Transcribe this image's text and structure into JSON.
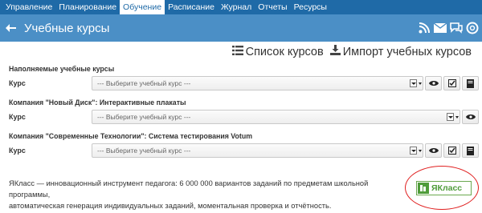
{
  "nav": {
    "items": [
      {
        "label": "Управление"
      },
      {
        "label": "Планирование"
      },
      {
        "label": "Обучение",
        "active": true
      },
      {
        "label": "Расписание"
      },
      {
        "label": "Журнал"
      },
      {
        "label": "Отчеты"
      },
      {
        "label": "Ресурсы"
      }
    ]
  },
  "page": {
    "title": "Учебные курсы",
    "header_icons": [
      "rss-icon",
      "mail-icon",
      "chat-icon",
      "help-icon"
    ]
  },
  "actions": {
    "list_label": "Список курсов",
    "import_label": "Импорт учебных курсов"
  },
  "sections": [
    {
      "title": "Наполняемые учебные курсы",
      "field_label": "Курс",
      "placeholder": "--- Выберите учебный курс ---"
    },
    {
      "title": "Компания \"Новый Диск\": Интерактивные плакаты",
      "field_label": "Курс",
      "placeholder": "--- Выберите учебный курс ---"
    },
    {
      "title": "Компания \"Современные Технологии\": Система тестирования Votum",
      "field_label": "Курс",
      "placeholder": "--- Выберите учебный курс ---"
    }
  ],
  "footer": {
    "line1": "ЯКласс — инновационный инструмент педагога: 6 000 000 вариантов заданий по предметам школьной программы,",
    "line2": "автоматическая генерация индивидуальных заданий, моментальная проверка и отчётность.",
    "logo_text": "ЯКласс"
  },
  "colors": {
    "nav_bg": "#1f6aa7",
    "title_bg": "#4b8fc6",
    "logo_green": "#4f9c3a",
    "highlight_red": "#e02020"
  }
}
